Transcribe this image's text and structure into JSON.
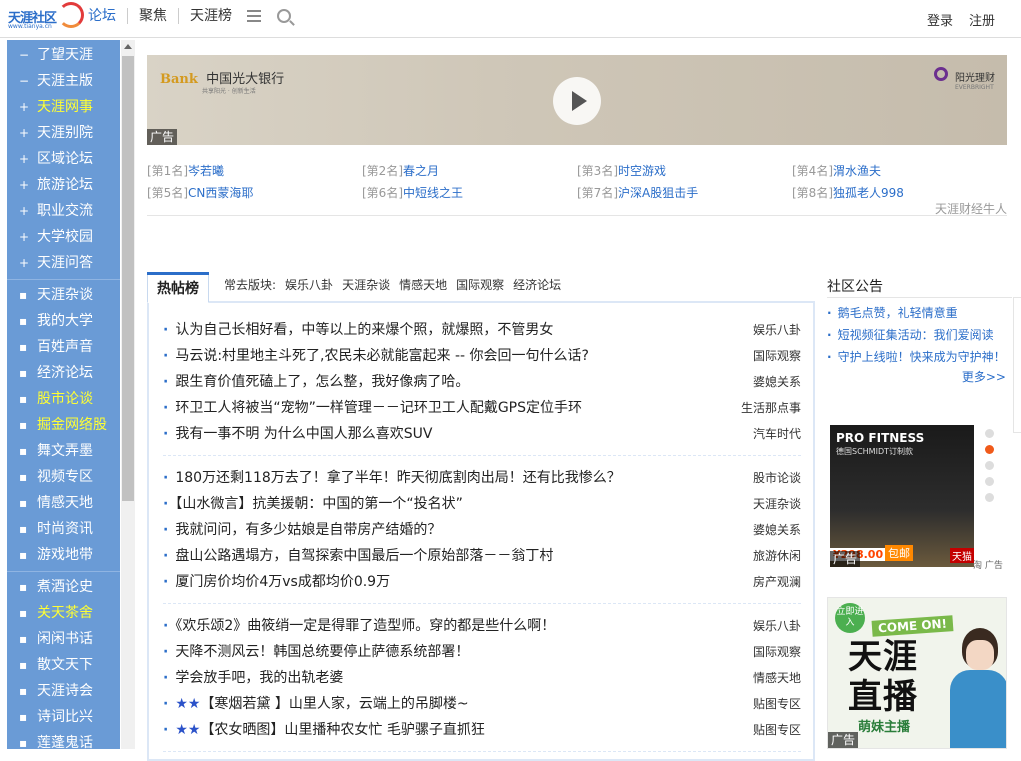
{
  "header": {
    "logo_text": "天涯社区",
    "logo_sub": "www.tianya.cn",
    "nav": [
      "论坛",
      "聚焦",
      "天涯榜"
    ],
    "login": "登录",
    "register": "注册"
  },
  "sidebar": {
    "groups": [
      [
        {
          "mark": "−",
          "label": "了望天涯",
          "highlight": false
        },
        {
          "mark": "−",
          "label": "天涯主版",
          "highlight": false
        },
        {
          "mark": "+",
          "label": "天涯网事",
          "highlight": true
        },
        {
          "mark": "+",
          "label": "天涯别院",
          "highlight": false
        },
        {
          "mark": "+",
          "label": "区域论坛",
          "highlight": false
        },
        {
          "mark": "+",
          "label": "旅游论坛",
          "highlight": false
        },
        {
          "mark": "+",
          "label": "职业交流",
          "highlight": false
        },
        {
          "mark": "+",
          "label": "大学校园",
          "highlight": false
        },
        {
          "mark": "+",
          "label": "天涯问答",
          "highlight": false
        }
      ],
      [
        {
          "mark": "▪",
          "label": "天涯杂谈",
          "highlight": false
        },
        {
          "mark": "▪",
          "label": "我的大学",
          "highlight": false
        },
        {
          "mark": "▪",
          "label": "百姓声音",
          "highlight": false
        },
        {
          "mark": "▪",
          "label": "经济论坛",
          "highlight": false
        },
        {
          "mark": "▪",
          "label": "股市论谈",
          "highlight": true
        },
        {
          "mark": "▪",
          "label": "掘金网络股",
          "highlight": true
        },
        {
          "mark": "▪",
          "label": "舞文弄墨",
          "highlight": false
        },
        {
          "mark": "▪",
          "label": "视频专区",
          "highlight": false
        },
        {
          "mark": "▪",
          "label": "情感天地",
          "highlight": false
        },
        {
          "mark": "▪",
          "label": "时尚资讯",
          "highlight": false
        },
        {
          "mark": "▪",
          "label": "游戏地带",
          "highlight": false
        }
      ],
      [
        {
          "mark": "▪",
          "label": "煮酒论史",
          "highlight": false
        },
        {
          "mark": "▪",
          "label": "关天茶舍",
          "highlight": true
        },
        {
          "mark": "▪",
          "label": "闲闲书话",
          "highlight": false
        },
        {
          "mark": "▪",
          "label": "散文天下",
          "highlight": false
        },
        {
          "mark": "▪",
          "label": "天涯诗会",
          "highlight": false
        },
        {
          "mark": "▪",
          "label": "诗词比兴",
          "highlight": false
        },
        {
          "mark": "▪",
          "label": "莲蓬鬼话",
          "highlight": false
        }
      ]
    ]
  },
  "banner": {
    "bank_prefix": "Bank",
    "bank_name": "中国光大银行",
    "bank_sub": "共享阳光 · 创新生活",
    "partner": "阳光理财",
    "partner_sub": "EVERBRIGHT",
    "ad_label": "广告"
  },
  "ranks": [
    {
      "no": "[第1名]",
      "name": "岑若曦"
    },
    {
      "no": "[第2名]",
      "name": "春之月"
    },
    {
      "no": "[第3名]",
      "name": "时空游戏"
    },
    {
      "no": "[第4名]",
      "name": "渭水渔夫"
    },
    {
      "no": "[第5名]",
      "name": "CN西蒙海耶"
    },
    {
      "no": "[第6名]",
      "name": "中短线之王"
    },
    {
      "no": "[第7名]",
      "name": "沪深A股狙击手"
    },
    {
      "no": "[第8名]",
      "name": "独孤老人998"
    }
  ],
  "ranks_footer": "天涯财经牛人",
  "hot": {
    "title": "热帖榜",
    "freq_label": "常去版块:",
    "freq": [
      "娱乐八卦",
      "天涯杂谈",
      "情感天地",
      "国际观察",
      "经济论坛"
    ],
    "groups": [
      [
        {
          "title": "认为自己长相好看，中等以上的来爆个照，就爆照，不管男女",
          "cat": "娱乐八卦"
        },
        {
          "title": "马云说:村里地主斗死了,农民未必就能富起来 -- 你会回一句什么话?",
          "cat": "国际观察"
        },
        {
          "title": "跟生育价值死磕上了，怎么整，我好像病了哈。",
          "cat": "婆媳关系"
        },
        {
          "title": "环卫工人将被当“宠物”一样管理－－记环卫工人配戴GPS定位手环",
          "cat": "生活那点事"
        },
        {
          "title": "我有一事不明 为什么中国人那么喜欢SUV",
          "cat": "汽车时代"
        }
      ],
      [
        {
          "title": "180万还剩118万去了！拿了半年！昨天彻底割肉出局！还有比我惨么？",
          "cat": "股市论谈"
        },
        {
          "title": "【山水微言】抗美援朝：中国的第一个“投名状”",
          "cat": "天涯杂谈"
        },
        {
          "title": "我就问问，有多少姑娘是自带房产结婚的？",
          "cat": "婆媳关系"
        },
        {
          "title": "盘山公路遇塌方，自驾探索中国最后一个原始部落－－翁丁村",
          "cat": "旅游休闲"
        },
        {
          "title": "厦门房价均价4万vs成都均价0.9万",
          "cat": "房产观澜"
        }
      ],
      [
        {
          "title": "《欢乐颂2》曲筱绡一定是得罪了造型师。穿的都是些什么啊！",
          "cat": "娱乐八卦"
        },
        {
          "title": "天降不测风云！韩国总统要停止萨德系统部署！",
          "cat": "国际观察"
        },
        {
          "title": "学会放手吧，我的出轨老婆",
          "cat": "情感天地"
        },
        {
          "title": "★★【寒烟若黛 】山里人家，云端上的吊脚楼~",
          "cat": "贴图专区"
        },
        {
          "title": "★★【农女晒图】山里播种农女忙  毛驴骡子直抓狂",
          "cat": "贴图专区"
        }
      ]
    ]
  },
  "notice": {
    "title": "社区公告",
    "items": [
      "鹅毛点赞，礼轻情意重",
      "短视频征集活动：我们爱阅读",
      "守护上线啦！快来成为守护神！"
    ],
    "more": "更多>>"
  },
  "ad2": {
    "title": "PRO FITNESS",
    "sub": "德国SCHMIDT订制款",
    "price": "¥298.00",
    "mail": "包邮",
    "tmall": "天猫",
    "small": "淘 广告",
    "label": "广告"
  },
  "ad3": {
    "badge": "立即进入",
    "come": "COME ON!",
    "line1": "天涯",
    "line2": "直播",
    "sub": "萌妹主播",
    "label": "广告"
  }
}
